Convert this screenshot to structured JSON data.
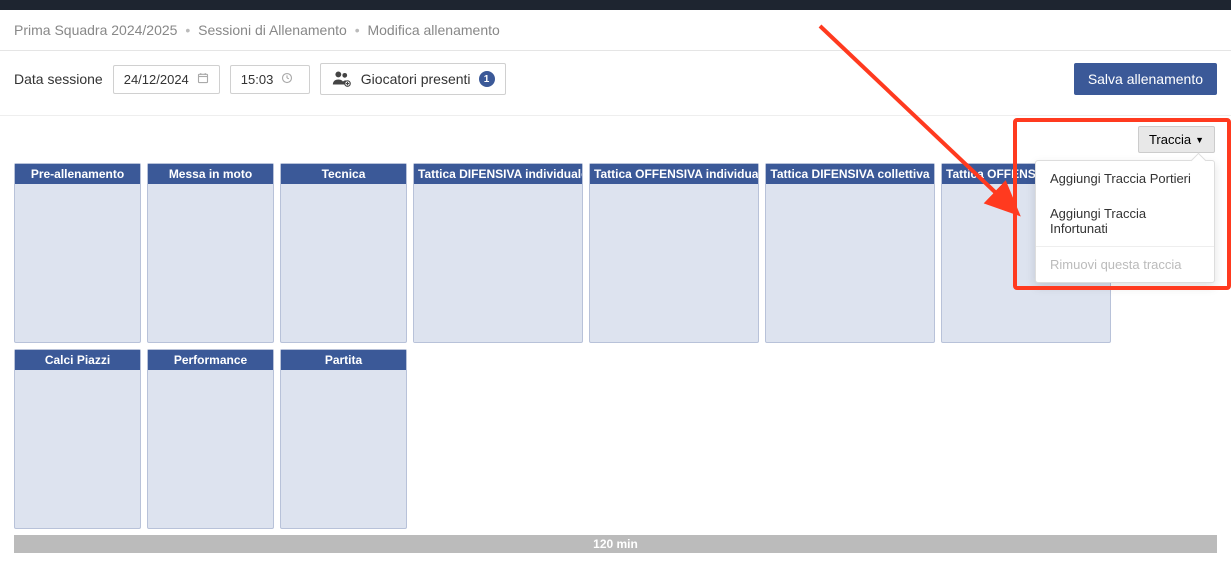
{
  "breadcrumb": {
    "item1": "Prima Squadra 2024/2025",
    "item2": "Sessioni di Allenamento",
    "item3": "Modifica allenamento"
  },
  "toolbar": {
    "date_label": "Data sessione",
    "date_value": "24/12/2024",
    "time_value": "15:03",
    "players_label": "Giocatori presenti",
    "players_count": "1",
    "save_label": "Salva allenamento"
  },
  "traccia": {
    "button_label": "Traccia",
    "menu": {
      "add_portieri": "Aggiungi Traccia Portieri",
      "add_infortunati": "Aggiungi Traccia Infortunati",
      "remove": "Rimuovi questa traccia"
    }
  },
  "cards_row1": [
    {
      "label": "Pre-allenamento",
      "size": "small"
    },
    {
      "label": "Messa in moto",
      "size": "small"
    },
    {
      "label": "Tecnica",
      "size": "small"
    },
    {
      "label": "Tattica DIFENSIVA individuale",
      "size": "wide",
      "narrow_body": true
    },
    {
      "label": "Tattica OFFENSIVA individuale",
      "size": "wide"
    },
    {
      "label": "Tattica DIFENSIVA collettiva",
      "size": "wide"
    },
    {
      "label": "Tattica OFFENSIVA collettiva",
      "size": "wide"
    }
  ],
  "cards_row2": [
    {
      "label": "Calci Piazzi",
      "size": "small"
    },
    {
      "label": "Performance",
      "size": "small"
    },
    {
      "label": "Partita",
      "size": "small"
    }
  ],
  "footer": {
    "duration": "120 min"
  }
}
